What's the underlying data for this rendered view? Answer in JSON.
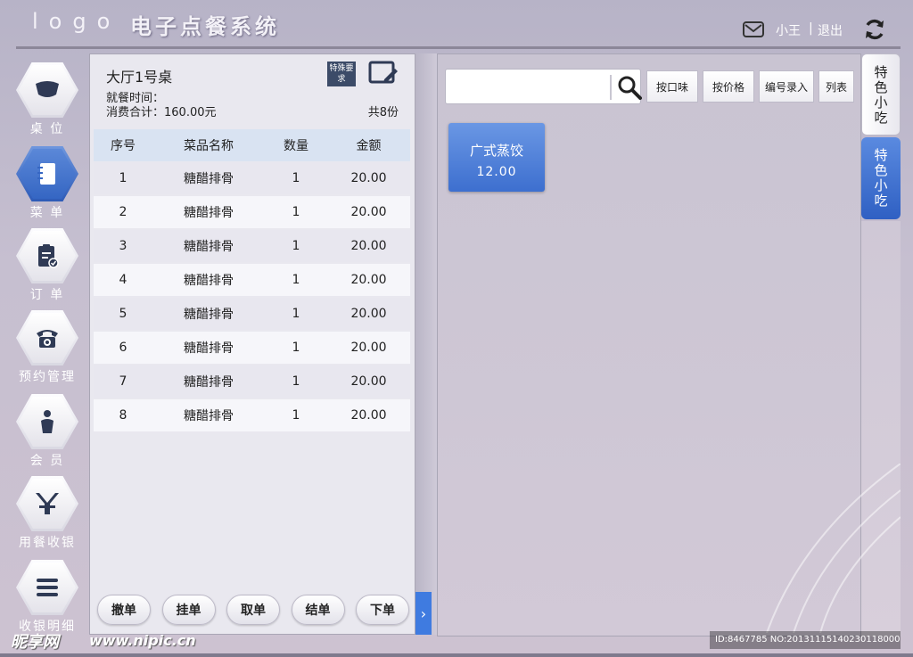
{
  "header": {
    "logo": "logo",
    "title": "电子点餐系统",
    "user": "小王",
    "separator": "|",
    "logout": "退出"
  },
  "sidebar": {
    "items": [
      {
        "label": "桌 位",
        "icon": "table-icon"
      },
      {
        "label": "菜 单",
        "icon": "menu-book-icon",
        "active": true
      },
      {
        "label": "订 单",
        "icon": "clipboard-check-icon"
      },
      {
        "label": "预约管理",
        "icon": "telephone-icon"
      },
      {
        "label": "会 员",
        "icon": "person-icon"
      },
      {
        "label": "用餐收银",
        "icon": "yen-icon"
      },
      {
        "label": "收银明细",
        "icon": "list-lines-icon"
      }
    ]
  },
  "order": {
    "table_name": "大厅1号桌",
    "dining_time": "就餐时间：",
    "total": "消费合计：160.00元",
    "count": "共8份",
    "special_label": "特殊要求",
    "columns": [
      "序号",
      "菜品名称",
      "数量",
      "金额"
    ],
    "rows": [
      [
        "1",
        "糖醋排骨",
        "1",
        "20.00"
      ],
      [
        "2",
        "糖醋排骨",
        "1",
        "20.00"
      ],
      [
        "3",
        "糖醋排骨",
        "1",
        "20.00"
      ],
      [
        "4",
        "糖醋排骨",
        "1",
        "20.00"
      ],
      [
        "5",
        "糖醋排骨",
        "1",
        "20.00"
      ],
      [
        "6",
        "糖醋排骨",
        "1",
        "20.00"
      ],
      [
        "7",
        "糖醋排骨",
        "1",
        "20.00"
      ],
      [
        "8",
        "糖醋排骨",
        "1",
        "20.00"
      ]
    ],
    "buttons": [
      "撤单",
      "挂单",
      "取单",
      "结单",
      "下单"
    ]
  },
  "search": {
    "placeholder": "",
    "value": ""
  },
  "filters": [
    "按口味",
    "按价格",
    "编号录入",
    "列表"
  ],
  "dishes": [
    {
      "name": "广式蒸饺",
      "price": "12.00"
    }
  ],
  "categories": [
    {
      "label": "特色小吃"
    },
    {
      "label": "特色小吃",
      "active": true
    }
  ],
  "watermark": {
    "brand": "昵享网",
    "url": "www.nipic.cn",
    "id": "ID:8467785 NO:20131115140230118000"
  },
  "colors": {
    "accent": "#3d6fcf",
    "special_bg": "#3c4b68"
  }
}
